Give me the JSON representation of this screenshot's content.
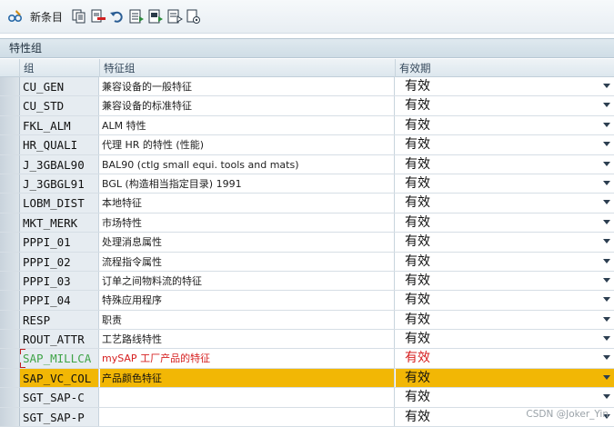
{
  "toolbar": {
    "new_entries_label": "新条目",
    "icons": [
      "glasses-edit-icon",
      "copy-icon",
      "delete-icon",
      "undo-icon",
      "select-all-icon",
      "select-block-icon",
      "deselect-icon",
      "settings-icon"
    ]
  },
  "panel": {
    "title": "特性组"
  },
  "table": {
    "columns": {
      "group": "组",
      "char_group": "特征组",
      "validity": "有效期"
    },
    "rows": [
      {
        "code": "CU_GEN",
        "desc": "兼容设备的一般特征",
        "valid": "有效"
      },
      {
        "code": "CU_STD",
        "desc": "兼容设备的标准特征",
        "valid": "有效"
      },
      {
        "code": "FKL_ALM",
        "desc": "ALM 特性",
        "valid": "有效"
      },
      {
        "code": "HR_QUALI",
        "desc": "代理 HR 的特性 (性能)",
        "valid": "有效"
      },
      {
        "code": "J_3GBAL90",
        "desc": "BAL90 (ctlg small equi. tools and mats)",
        "valid": "有效"
      },
      {
        "code": "J_3GBGL91",
        "desc": "BGL (构造相当指定目录) 1991",
        "valid": "有效"
      },
      {
        "code": "LOBM_DIST",
        "desc": "本地特征",
        "valid": "有效"
      },
      {
        "code": "MKT_MERK",
        "desc": "市场特性",
        "valid": "有效"
      },
      {
        "code": "PPPI_01",
        "desc": "处理消息属性",
        "valid": "有效"
      },
      {
        "code": "PPPI_02",
        "desc": "流程指令属性",
        "valid": "有效"
      },
      {
        "code": "PPPI_03",
        "desc": "订单之间物料流的特征",
        "valid": "有效"
      },
      {
        "code": "PPPI_04",
        "desc": "特殊应用程序",
        "valid": "有效"
      },
      {
        "code": "RESP",
        "desc": "职责",
        "valid": "有效"
      },
      {
        "code": "ROUT_ATTR",
        "desc": "工艺路线特性",
        "valid": "有效"
      },
      {
        "code": "SAP_MILLCA",
        "desc": "mySAP 工厂产品的特征",
        "valid": "有效"
      },
      {
        "code": "SAP_VC_COL",
        "desc": "产品颜色特征",
        "valid": "有效"
      },
      {
        "code": "SGT_SAP-C",
        "desc": "",
        "valid": "有效"
      },
      {
        "code": "SGT_SAP-P",
        "desc": "",
        "valid": "有效"
      }
    ]
  },
  "watermark": "CSDN @Joker_Yin",
  "colors": {
    "highlight": "#f2b705",
    "red_text": "#d62020",
    "green_code": "#3fa347"
  }
}
